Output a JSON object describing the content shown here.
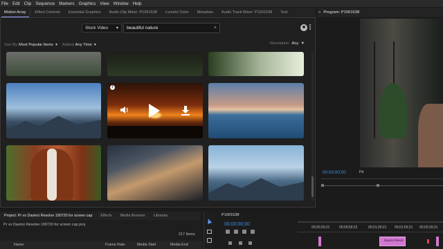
{
  "menu": [
    "File",
    "Edit",
    "Clip",
    "Sequence",
    "Markers",
    "Graphics",
    "View",
    "Window",
    "Help"
  ],
  "top_tabs": [
    "Motion Array",
    "Effect Controls",
    "Essential Graphics",
    "Audio Clip Mixer: P1001538",
    "Lumetri Color",
    "Metadata",
    "Audio Track Mixer: P1001538",
    "Text"
  ],
  "search": {
    "type_select": "Stock Video",
    "query": "beautiful nature"
  },
  "filters": {
    "sort_label": "Sort By",
    "sort_value": "Most Popular Items",
    "added_label": "Added",
    "added_value": "Any Time",
    "resolution_label": "Resolution",
    "resolution_value": "Any"
  },
  "info_glyph": "i",
  "program": {
    "title": "Program: P1001538",
    "timecode": "00;00;00;00",
    "fit": "Fit"
  },
  "bottom_tabs": [
    "Project: Pr vs Davinci Resolve 190720 for screen cap",
    "Effects",
    "Media Browser",
    "Libraries"
  ],
  "project": {
    "file": "Pr vs Davinci Resolve 190720 for screen cap proj",
    "items": "217 Items",
    "columns": [
      "Name",
      "Frame Rate",
      "Media Start",
      "Media End"
    ]
  },
  "sequence": {
    "tab": "P1001538",
    "timecode": "00;00;00;00",
    "ruler": [
      "00;00;29;21",
      "00;00;59;22",
      "00;01;29;21",
      "00;01;59;21",
      "00;02;29;21"
    ],
    "clip_label": "Davinci Resol"
  },
  "colors": {
    "accent_blue": "#3d8fe6",
    "clip_pink": "#d178d0",
    "tab_underline": "#9ea4ff"
  }
}
